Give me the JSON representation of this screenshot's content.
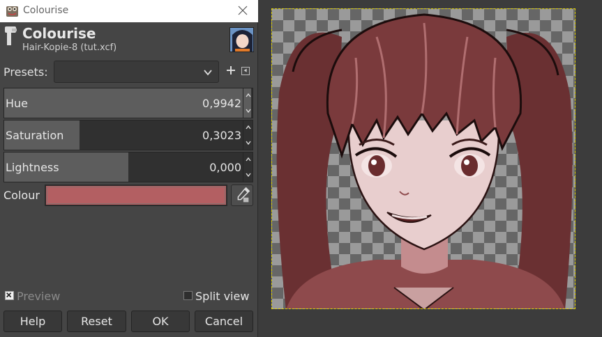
{
  "window": {
    "title": "Colourise"
  },
  "header": {
    "title": "Colourise",
    "subtitle": "Hair-Kopie-8 (tut.xcf)"
  },
  "presets": {
    "label": "Presets:",
    "value": ""
  },
  "sliders": [
    {
      "label": "Hue",
      "value": "0,9942",
      "fraction": 0.9942
    },
    {
      "label": "Saturation",
      "value": "0,3023",
      "fraction": 0.3023
    },
    {
      "label": "Lightness",
      "value": "0,000",
      "fraction": 0.5
    }
  ],
  "colour": {
    "label": "Colour",
    "swatch": "#b35f62"
  },
  "options": {
    "preview": {
      "label": "Preview",
      "checked": true
    },
    "split_view": {
      "label": "Split view",
      "checked": false
    }
  },
  "buttons": {
    "help": "Help",
    "reset": "Reset",
    "ok": "OK",
    "cancel": "Cancel"
  },
  "colors": {
    "tint": "#8e4a4c",
    "selection": "#e5d600"
  }
}
